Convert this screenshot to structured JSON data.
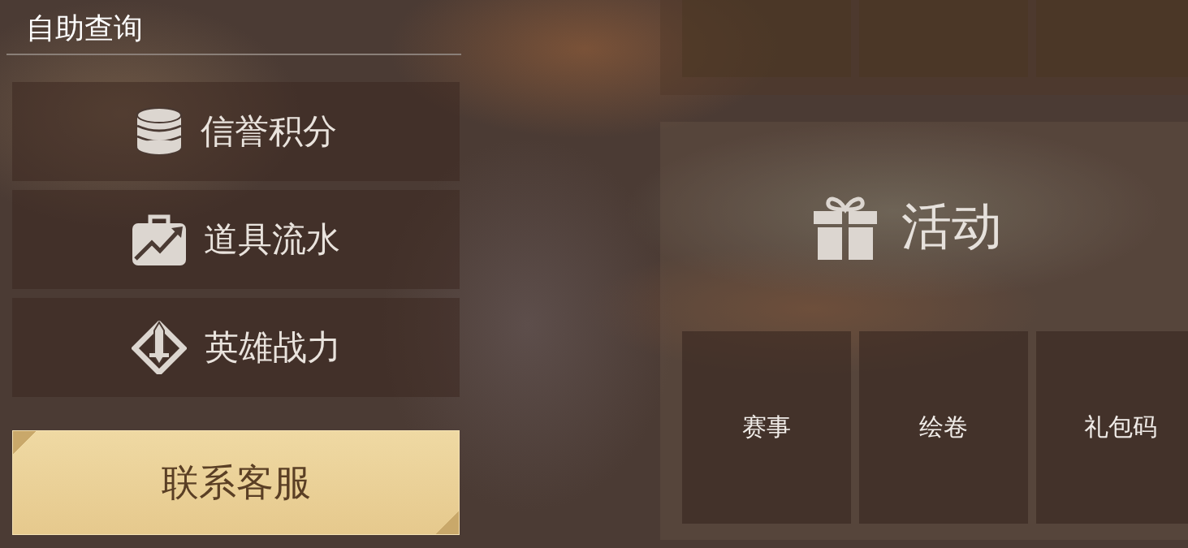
{
  "section_title": "自助查询",
  "query_items": [
    {
      "label": "信誉积分",
      "kind": "coins"
    },
    {
      "label": "道具流水",
      "kind": "chart"
    },
    {
      "label": "英雄战力",
      "kind": "sword"
    }
  ],
  "contact_button": "联系客服",
  "activity": {
    "title": "活动",
    "tiles": [
      "赛事",
      "绘卷",
      "礼包码"
    ]
  }
}
